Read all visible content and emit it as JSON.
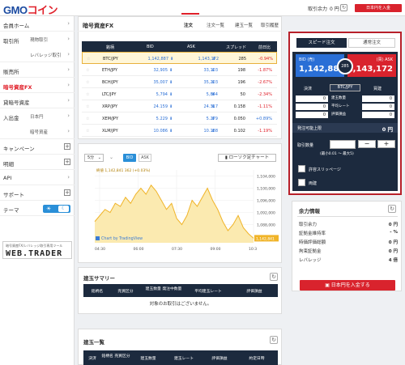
{
  "header": {
    "logo": "GMOコイン",
    "margin_label": "取引余力",
    "margin_value": "0 円",
    "deposit_button": "日本円を入金"
  },
  "sidebar": {
    "items": [
      {
        "label": "会員ホーム",
        "sub": ""
      },
      {
        "label": "取引所",
        "sub": "現物取引"
      },
      {
        "label": "",
        "sub": "レバレッジ取引"
      },
      {
        "label": "販売所",
        "sub": ""
      },
      {
        "label": "暗号資産FX",
        "sub": ""
      },
      {
        "label": "貸暗号資産",
        "sub": ""
      },
      {
        "label": "入出金",
        "sub": "日本円"
      },
      {
        "label": "",
        "sub": "暗号資産"
      },
      {
        "label": "キャンペーン",
        "sub": ""
      },
      {
        "label": "明細",
        "sub": ""
      },
      {
        "label": "API",
        "sub": ""
      },
      {
        "label": "サポート",
        "sub": ""
      },
      {
        "label": "テーマ",
        "sub": ""
      }
    ],
    "banner_small": "暗号資産FX/レバレッジ取引専用ツール",
    "banner_big": "WEB.TRADER"
  },
  "fx": {
    "title": "暗号資産FX",
    "tabs": [
      "注文",
      "注文一覧",
      "建玉一覧",
      "取引履歴"
    ],
    "columns": [
      "銘柄",
      "BID",
      "ASK",
      "スプレッド",
      "前日比"
    ],
    "rows": [
      {
        "symbol": "BTC/JPY",
        "bid": "1,142,887",
        "ask": "1,143,172",
        "spread": "285",
        "change": "-0.94%",
        "dir": "down"
      },
      {
        "symbol": "ETH/JPY",
        "bid": "32,905",
        "ask": "33,103",
        "spread": "198",
        "change": "-1.87%",
        "dir": "down"
      },
      {
        "symbol": "BCH/JPY",
        "bid": "35,007",
        "ask": "35,203",
        "spread": "196",
        "change": "-2.67%",
        "dir": "down"
      },
      {
        "symbol": "LTC/JPY",
        "bid": "5,794",
        "ask": "5,844",
        "spread": "50",
        "change": "-2.34%",
        "dir": "down"
      },
      {
        "symbol": "XRP/JPY",
        "bid": "24.159",
        "ask": "24.317",
        "spread": "0.158",
        "change": "-1.11%",
        "dir": "down"
      },
      {
        "symbol": "XEM/JPY",
        "bid": "5.229",
        "ask": "5.279",
        "spread": "0.050",
        "change": "+0.89%",
        "dir": "up"
      },
      {
        "symbol": "XLM/JPY",
        "bid": "10.086",
        "ask": "10.188",
        "spread": "0.102",
        "change": "-1.19%",
        "dir": "down"
      }
    ]
  },
  "chart": {
    "period": "5分",
    "bid_label": "BID",
    "ask_label": "ASK",
    "candle_button": "ローソク足チャート",
    "legend": "終値 1,142,841 362 (+0.03%)",
    "credit": "Chart by TradingView",
    "last_price_tag": "1,142,841"
  },
  "chart_data": {
    "type": "area",
    "x_ticks": [
      "04:30",
      "06:00",
      "07:30",
      "09:00",
      "10:3"
    ],
    "y_ticks": [
      "1,104,000",
      "1,100,000",
      "1,096,000",
      "1,092,000",
      "1,088,000",
      "1,084,000"
    ],
    "ylim": [
      1082000,
      1106000
    ],
    "values": [
      1089000,
      1091000,
      1093000,
      1092000,
      1095000,
      1094000,
      1097000,
      1095000,
      1098000,
      1100000,
      1098000,
      1101000,
      1099000,
      1096000,
      1093000,
      1095000,
      1090000,
      1088000,
      1091000,
      1096000,
      1094000,
      1097000,
      1100000,
      1096000,
      1093000,
      1089000,
      1086000,
      1088000,
      1091000,
      1087000,
      1085000,
      1083500
    ]
  },
  "summary": {
    "title": "建玉サマリー",
    "columns": [
      "銘柄名",
      "売買区分",
      "建玉数量 発注中数量",
      "平均建玉レート",
      "評価損益"
    ],
    "empty": "対象のお取引はございません。"
  },
  "positions": {
    "title": "建玉一覧",
    "columns": [
      "決済",
      "銘柄名 売買区分",
      "建玉数量",
      "建玉レート",
      "評価損益",
      "約定日時"
    ]
  },
  "order": {
    "tab_speed": "スピード注文",
    "tab_normal": "通常注文",
    "bid_label": "BID (売)",
    "ask_label": "(買) ASK",
    "bid": "1,142,887",
    "ask": "1,143,172",
    "spread": "285",
    "settle_label": "決済",
    "symbol": "BTC/JPY",
    "newpos_label": "買建",
    "left_value": "0",
    "right_value": "0",
    "qty_labels": [
      "建玉数量",
      "平均レート",
      "評価損益"
    ],
    "qty_values": [
      "0",
      "0",
      "0"
    ],
    "limit_label": "発注可能上限",
    "limit_value": "0 円",
    "amount_label": "取引数量",
    "amount_hint": "(最小0.01 〜 最大5)",
    "minus": "−",
    "plus": "+",
    "slippage_label": "許容スリッページ",
    "repeat_label": "両建"
  },
  "margin_info": {
    "title": "余力情報",
    "rows": [
      {
        "k": "取引余力",
        "v": "0 円"
      },
      {
        "k": "証拠金維持率",
        "v": "- %"
      },
      {
        "k": "時価評価総額",
        "v": "0 円"
      },
      {
        "k": "拘束証拠金",
        "v": "0 円"
      },
      {
        "k": "レバレッジ",
        "v": "4 倍"
      }
    ],
    "deposit_button": "日本円を入金する"
  },
  "colors": {
    "brand_red": "#e0202a",
    "navy": "#1c2a3e",
    "bid_blue": "#2a6fd6",
    "ask_red": "#d9232d"
  }
}
